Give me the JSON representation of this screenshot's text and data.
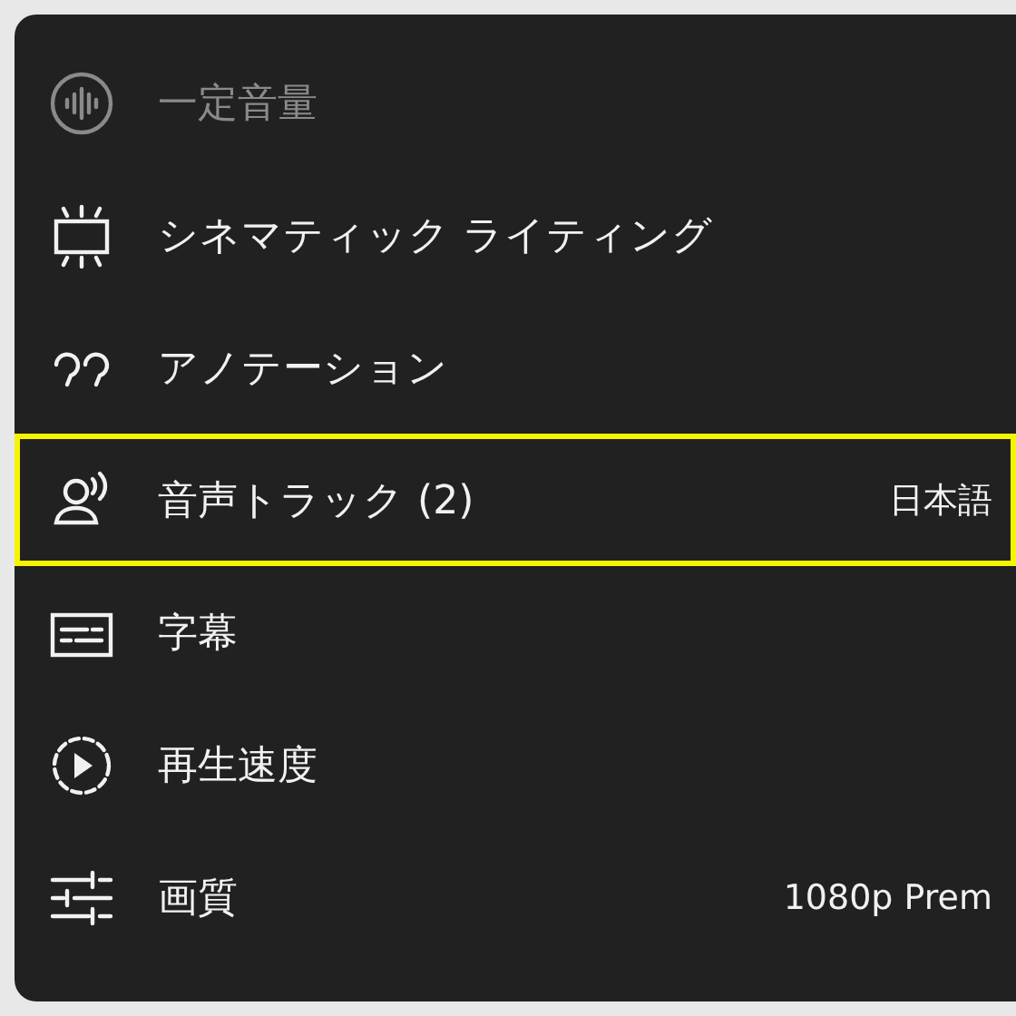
{
  "menu_items": [
    {
      "kind": "stable-volume",
      "label": "一定音量",
      "disabled": true,
      "highlighted": false
    },
    {
      "kind": "ambient",
      "label": "シネマティック ライティング",
      "disabled": false,
      "highlighted": false
    },
    {
      "kind": "annotations",
      "label": "アノテーション",
      "disabled": false,
      "highlighted": false
    },
    {
      "kind": "audio",
      "label": "音声トラック (2)",
      "value": "日本語",
      "disabled": false,
      "highlighted": true
    },
    {
      "kind": "subtitles",
      "label": "字幕",
      "disabled": false,
      "highlighted": false
    },
    {
      "kind": "speed",
      "label": "再生速度",
      "disabled": false,
      "highlighted": false
    },
    {
      "kind": "quality",
      "label": "画質",
      "value": "1080p Prem",
      "disabled": false,
      "highlighted": false
    }
  ]
}
